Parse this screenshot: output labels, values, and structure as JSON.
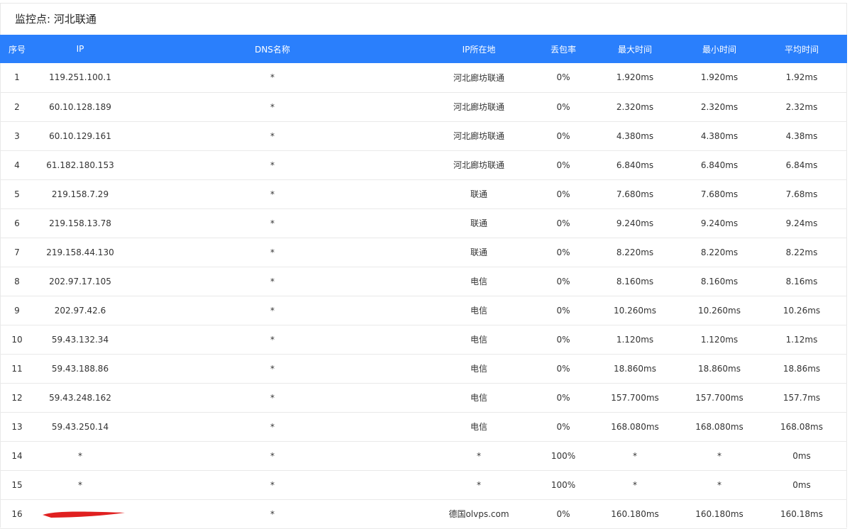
{
  "panel": {
    "title": "监控点: 河北联通"
  },
  "table": {
    "headers": [
      "序号",
      "IP",
      "DNS名称",
      "IP所在地",
      "丢包率",
      "最大时间",
      "最小时间",
      "平均时间"
    ],
    "rows": [
      {
        "index": "1",
        "ip": "119.251.100.1",
        "dns": "*",
        "location": "河北廊坊联通",
        "loss": "0%",
        "max": "1.920ms",
        "min": "1.920ms",
        "avg": "1.92ms"
      },
      {
        "index": "2",
        "ip": "60.10.128.189",
        "dns": "*",
        "location": "河北廊坊联通",
        "loss": "0%",
        "max": "2.320ms",
        "min": "2.320ms",
        "avg": "2.32ms"
      },
      {
        "index": "3",
        "ip": "60.10.129.161",
        "dns": "*",
        "location": "河北廊坊联通",
        "loss": "0%",
        "max": "4.380ms",
        "min": "4.380ms",
        "avg": "4.38ms"
      },
      {
        "index": "4",
        "ip": "61.182.180.153",
        "dns": "*",
        "location": "河北廊坊联通",
        "loss": "0%",
        "max": "6.840ms",
        "min": "6.840ms",
        "avg": "6.84ms"
      },
      {
        "index": "5",
        "ip": "219.158.7.29",
        "dns": "*",
        "location": "联通",
        "loss": "0%",
        "max": "7.680ms",
        "min": "7.680ms",
        "avg": "7.68ms"
      },
      {
        "index": "6",
        "ip": "219.158.13.78",
        "dns": "*",
        "location": "联通",
        "loss": "0%",
        "max": "9.240ms",
        "min": "9.240ms",
        "avg": "9.24ms"
      },
      {
        "index": "7",
        "ip": "219.158.44.130",
        "dns": "*",
        "location": "联通",
        "loss": "0%",
        "max": "8.220ms",
        "min": "8.220ms",
        "avg": "8.22ms"
      },
      {
        "index": "8",
        "ip": "202.97.17.105",
        "dns": "*",
        "location": "电信",
        "loss": "0%",
        "max": "8.160ms",
        "min": "8.160ms",
        "avg": "8.16ms"
      },
      {
        "index": "9",
        "ip": "202.97.42.6",
        "dns": "*",
        "location": "电信",
        "loss": "0%",
        "max": "10.260ms",
        "min": "10.260ms",
        "avg": "10.26ms"
      },
      {
        "index": "10",
        "ip": "59.43.132.34",
        "dns": "*",
        "location": "电信",
        "loss": "0%",
        "max": "1.120ms",
        "min": "1.120ms",
        "avg": "1.12ms"
      },
      {
        "index": "11",
        "ip": "59.43.188.86",
        "dns": "*",
        "location": "电信",
        "loss": "0%",
        "max": "18.860ms",
        "min": "18.860ms",
        "avg": "18.86ms"
      },
      {
        "index": "12",
        "ip": "59.43.248.162",
        "dns": "*",
        "location": "电信",
        "loss": "0%",
        "max": "157.700ms",
        "min": "157.700ms",
        "avg": "157.7ms"
      },
      {
        "index": "13",
        "ip": "59.43.250.14",
        "dns": "*",
        "location": "电信",
        "loss": "0%",
        "max": "168.080ms",
        "min": "168.080ms",
        "avg": "168.08ms"
      },
      {
        "index": "14",
        "ip": "*",
        "dns": "*",
        "location": "*",
        "loss": "100%",
        "max": "*",
        "min": "*",
        "avg": "0ms"
      },
      {
        "index": "15",
        "ip": "*",
        "dns": "*",
        "location": "*",
        "loss": "100%",
        "max": "*",
        "min": "*",
        "avg": "0ms"
      },
      {
        "index": "16",
        "ip": "",
        "ip_redacted": true,
        "dns": "*",
        "location": "德国olvps.com",
        "loss": "0%",
        "max": "160.180ms",
        "min": "160.180ms",
        "avg": "160.18ms"
      }
    ]
  },
  "colors": {
    "header_bg": "#2a7ffc",
    "header_text": "#ffffff",
    "row_border": "#e9e9e9",
    "redaction": "#e02020"
  }
}
